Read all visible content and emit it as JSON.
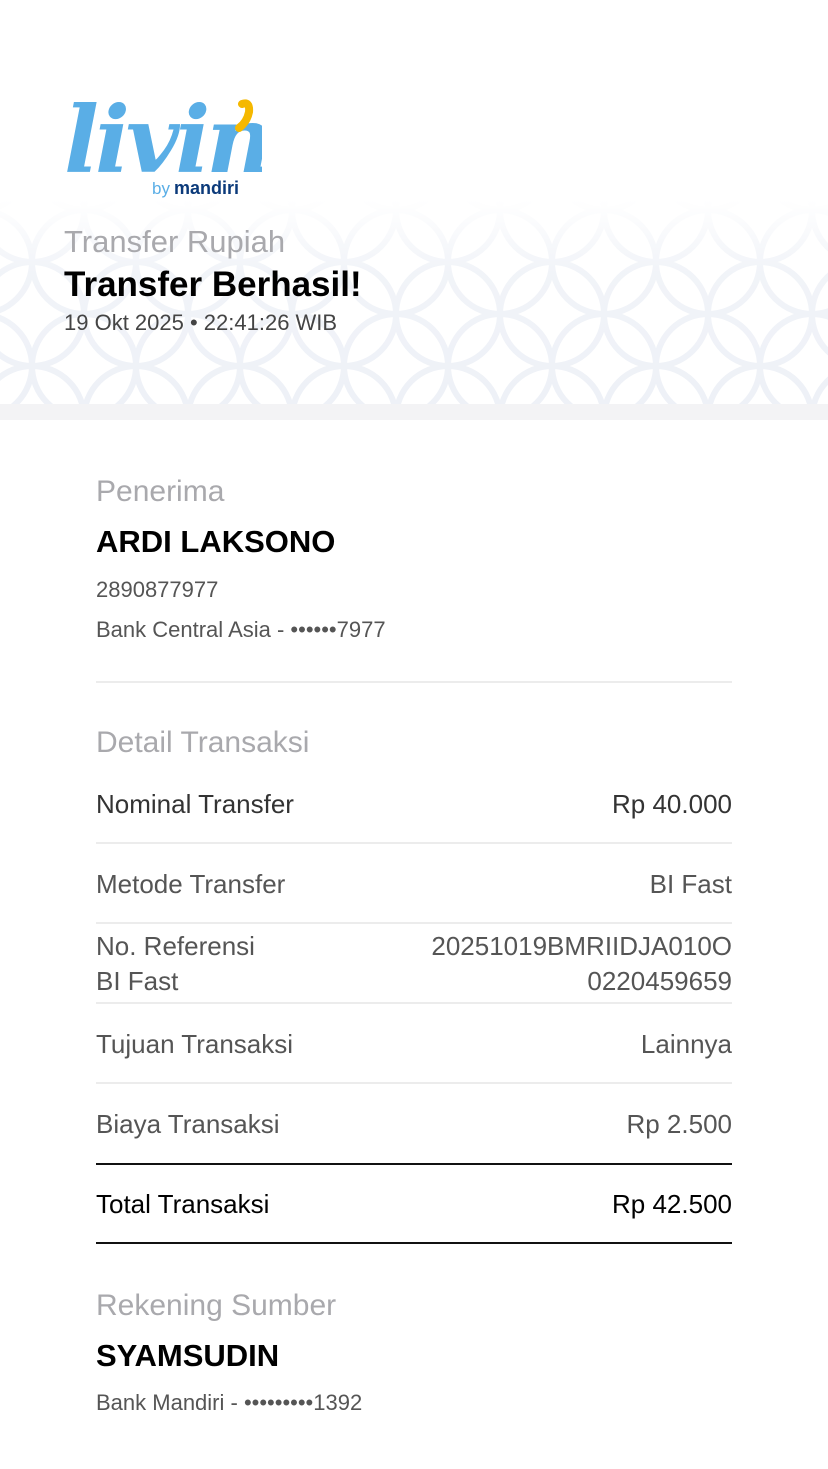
{
  "header": {
    "logo": {
      "wordmark": "livin'",
      "by": "by",
      "brand": "mandiri"
    },
    "subtitle": "Transfer Rupiah",
    "title": "Transfer Berhasil!",
    "datetime": "19 Okt 2025 • 22:41:26 WIB"
  },
  "recipient": {
    "section_label": "Penerima",
    "name": "ARDI LAKSONO",
    "account_number": "2890877977",
    "bank_masked": "Bank Central Asia - ••••••7977"
  },
  "details": {
    "section_label": "Detail Transaksi",
    "nominal": {
      "label": "Nominal Transfer",
      "value": "Rp 40.000"
    },
    "method": {
      "label": "Metode Transfer",
      "value": "BI Fast"
    },
    "reference": {
      "label_line1": "No. Referensi",
      "label_line2": "BI Fast",
      "value_line1": "20251019BMRIIDJA010O",
      "value_line2": "0220459659"
    },
    "purpose": {
      "label": "Tujuan Transaksi",
      "value": "Lainnya"
    },
    "fee": {
      "label": "Biaya Transaksi",
      "value": "Rp 2.500"
    },
    "total": {
      "label": "Total Transaksi",
      "value": "Rp 42.500"
    }
  },
  "source": {
    "section_label": "Rekening Sumber",
    "name": "SYAMSUDIN",
    "bank_masked": "Bank Mandiri - •••••••••1392"
  },
  "colors": {
    "logo_blue": "#5aaee6",
    "logo_accent": "#f5b800",
    "mandiri_navy": "#0b3a7a",
    "muted_text": "#a9a9ad"
  }
}
